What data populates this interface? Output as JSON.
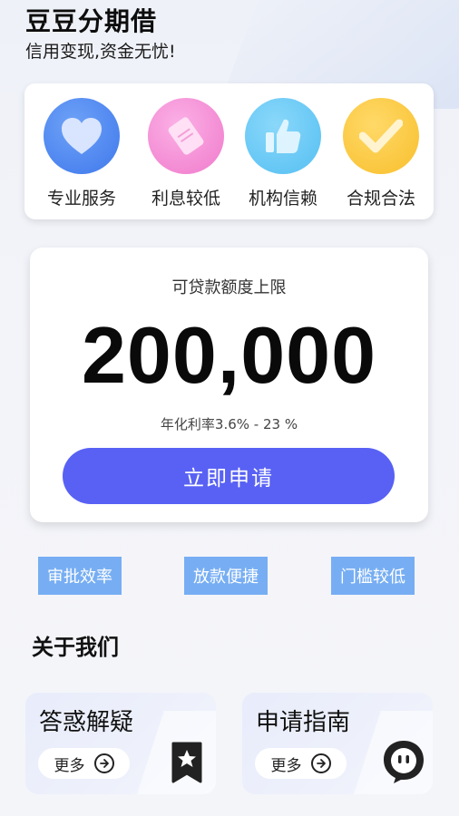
{
  "header": {
    "title": "豆豆分期借",
    "subtitle": "信用变现,资金无忧!"
  },
  "features": [
    {
      "label": "专业服务",
      "icon": "heart-icon",
      "color": "#4a86f2"
    },
    {
      "label": "利息较低",
      "icon": "ticket-icon",
      "color": "#f58fd6"
    },
    {
      "label": "机构信赖",
      "icon": "thumbs-up-icon",
      "color": "#60c6f4"
    },
    {
      "label": "合规合法",
      "icon": "check-icon",
      "color": "#fbc93d"
    }
  ],
  "loan": {
    "label": "可贷款额度上限",
    "amount": "200,000",
    "rate": "年化利率3.6% - 23 %",
    "apply_label": "立即申请",
    "button_color": "#5861f4"
  },
  "tags": [
    "审批效率",
    "放款便捷",
    "门槛较低"
  ],
  "about": {
    "title": "关于我们",
    "cards": [
      {
        "title": "答惑解疑",
        "more": "更多",
        "icon": "bookmark-star-icon"
      },
      {
        "title": "申请指南",
        "more": "更多",
        "icon": "chat-bot-icon"
      }
    ]
  }
}
